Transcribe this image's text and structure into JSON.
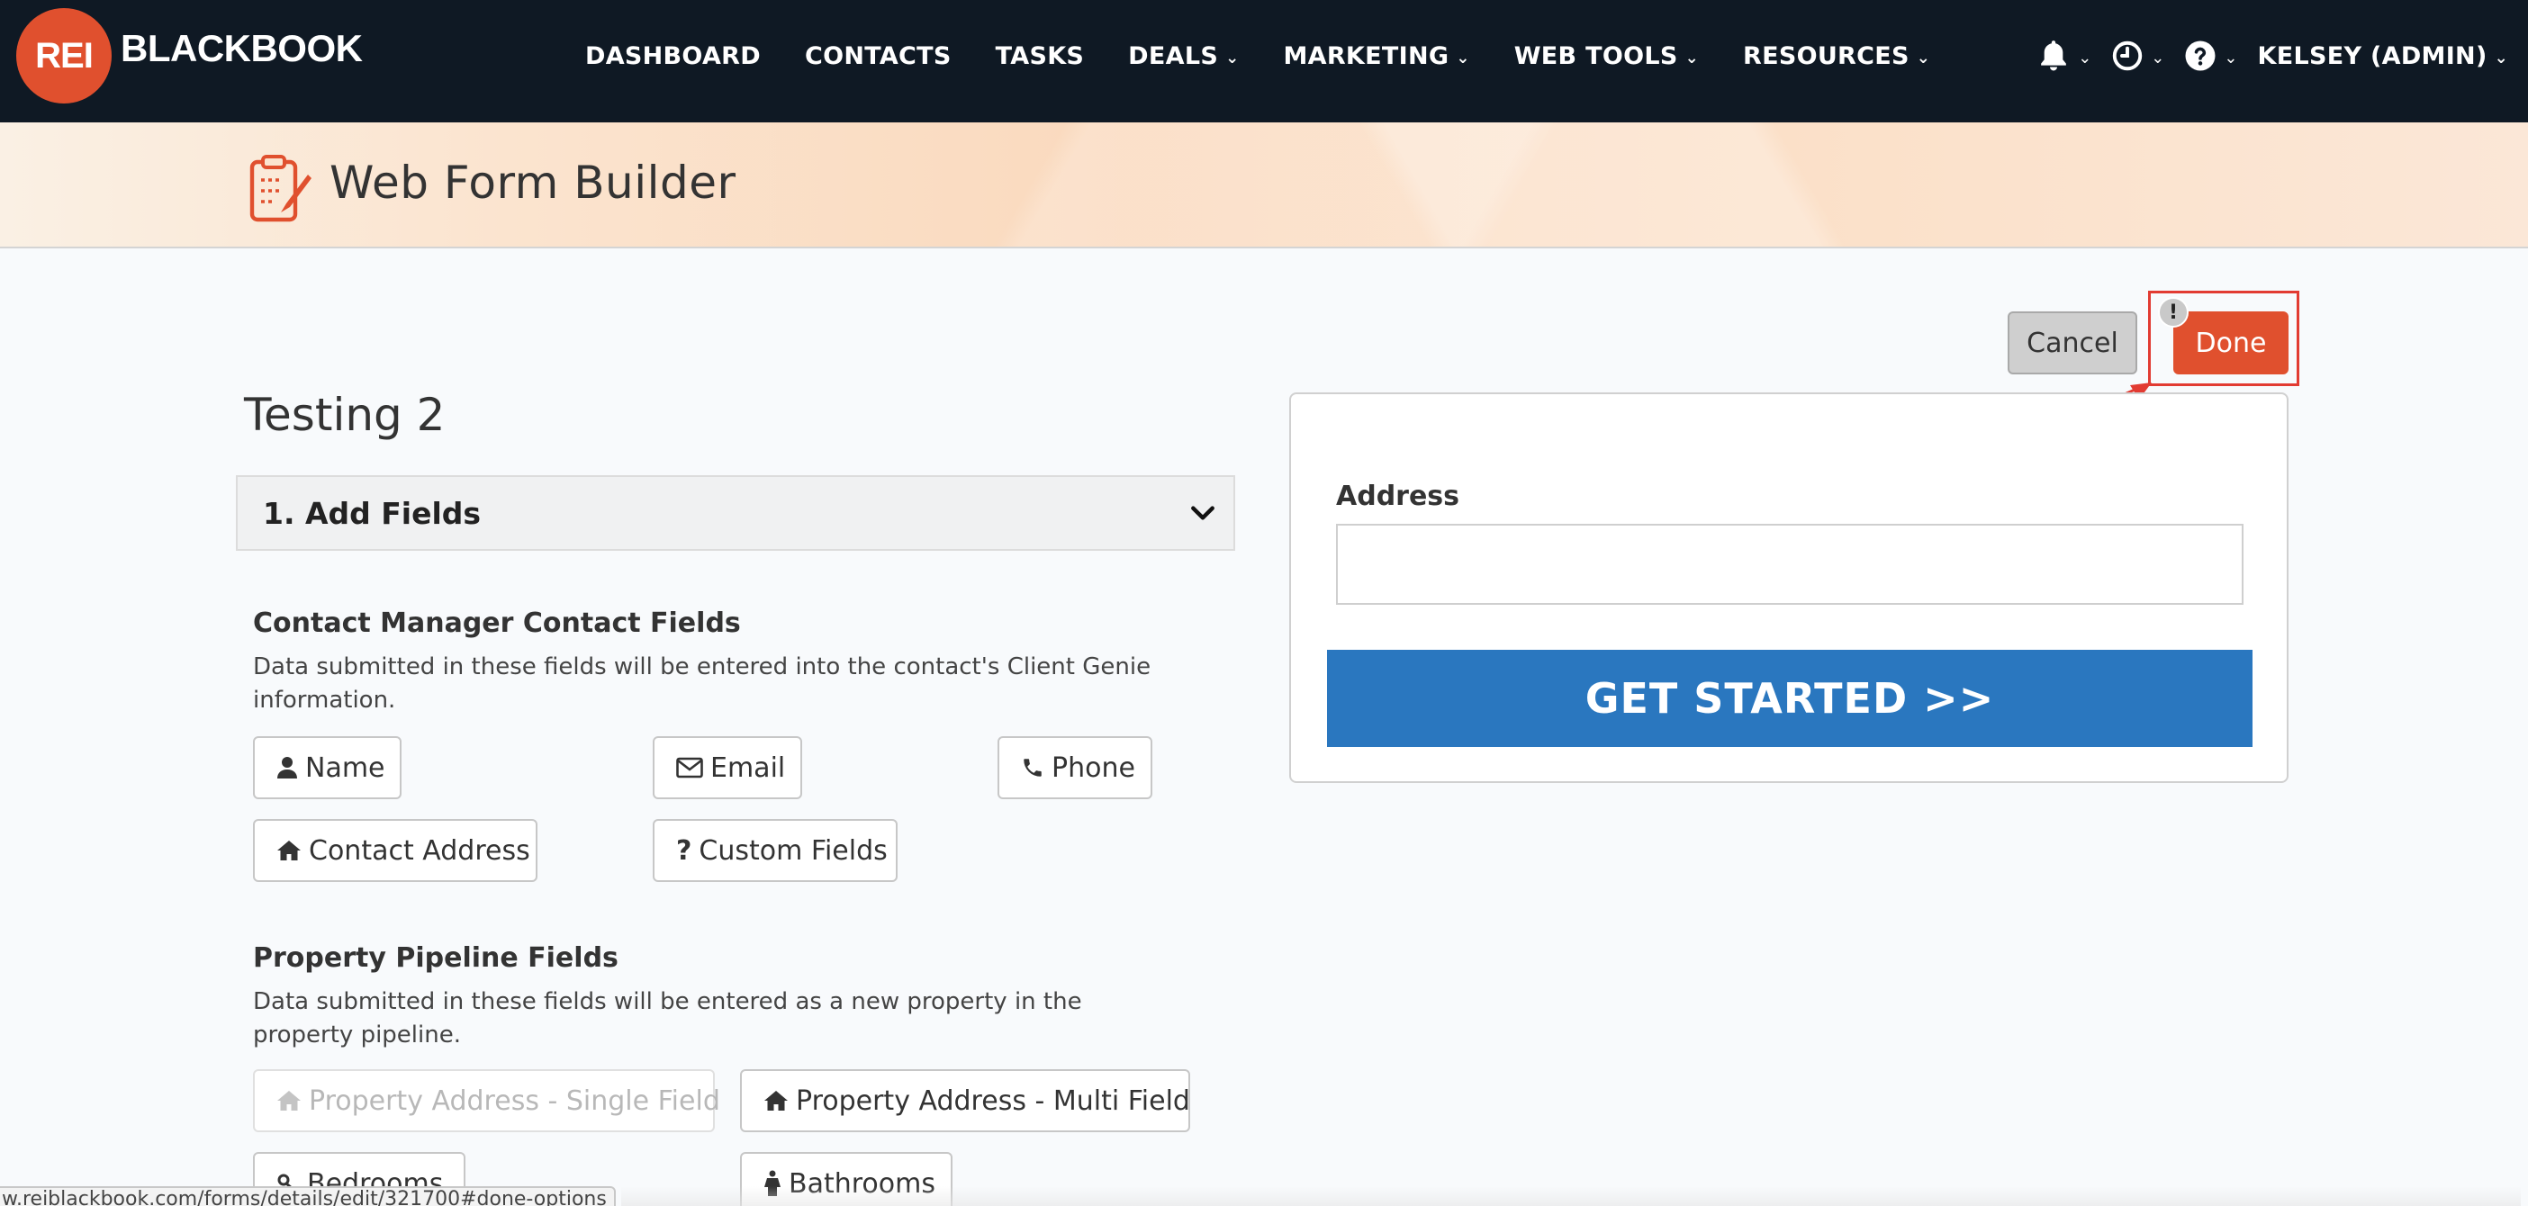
{
  "brand": {
    "badge": "REI",
    "word": "BLACKBOOK",
    "accent": "#e0502e"
  },
  "nav": {
    "items": [
      {
        "label": "DASHBOARD",
        "dropdown": false
      },
      {
        "label": "CONTACTS",
        "dropdown": false
      },
      {
        "label": "TASKS",
        "dropdown": false
      },
      {
        "label": "DEALS",
        "dropdown": true
      },
      {
        "label": "MARKETING",
        "dropdown": true
      },
      {
        "label": "WEB TOOLS",
        "dropdown": true
      },
      {
        "label": "RESOURCES",
        "dropdown": true
      }
    ],
    "caret": "⌄",
    "user": "KELSEY (ADMIN)",
    "icons": [
      "bell-icon",
      "clock-icon",
      "help-icon"
    ]
  },
  "header": {
    "title": "Web Form Builder",
    "icon": "form-edit-icon"
  },
  "actions": {
    "cancel_label": "Cancel",
    "done_label": "Done",
    "warning_badge": "!"
  },
  "builder": {
    "form_name": "Testing 2",
    "accordion_title": "1. Add Fields",
    "contact_section": {
      "title": "Contact Manager Contact Fields",
      "description": "Data submitted in these fields will be entered into the contact's Client Genie information.",
      "fields": [
        {
          "label": "Name",
          "icon": "user-icon"
        },
        {
          "label": "Email",
          "icon": "envelope-icon"
        },
        {
          "label": "Phone",
          "icon": "phone-icon"
        },
        {
          "label": "Contact Address",
          "icon": "home-icon"
        },
        {
          "label": "Custom Fields",
          "icon": "question-icon"
        }
      ]
    },
    "property_section": {
      "title": "Property Pipeline Fields",
      "description": "Data submitted in these fields will be entered as a new property in the property pipeline.",
      "fields": [
        {
          "label": "Property Address - Single Field",
          "icon": "home-icon",
          "disabled": true
        },
        {
          "label": "Property Address - Multi Field",
          "icon": "home-icon",
          "disabled": false
        },
        {
          "label": "Bedrooms",
          "icon": "bed-icon",
          "disabled": false
        },
        {
          "label": "Bathrooms",
          "icon": "bath-icon",
          "disabled": false
        }
      ]
    }
  },
  "preview": {
    "field_label": "Address",
    "field_value": "",
    "submit_label": "GET STARTED >>",
    "submit_color": "#2a77bf"
  },
  "status_bar": {
    "url": "w.reiblackbook.com/forms/details/edit/321700#done-options"
  }
}
